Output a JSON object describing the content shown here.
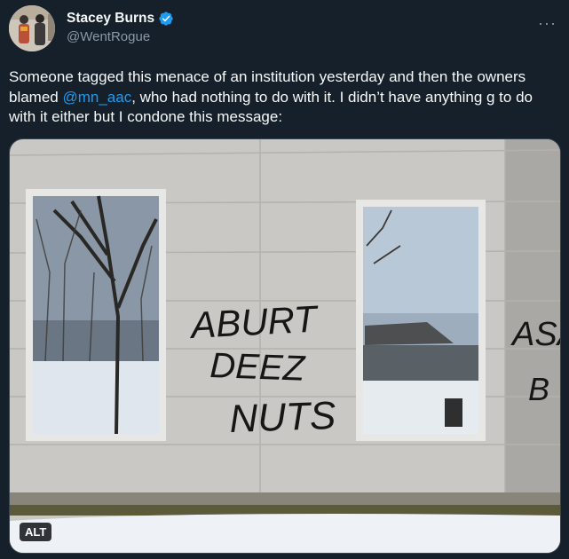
{
  "author": {
    "display_name": "Stacey Burns",
    "handle": "@WentRogue",
    "verified_icon": "verified-badge-icon"
  },
  "tweet": {
    "text_part1": "Someone tagged this menace of an institution yesterday and then the owners blamed ",
    "mention": "@mn_aac",
    "text_part2": ", who had nothing to do with it. I didn’t have anything g to do with it either but I condone this message:"
  },
  "media": {
    "graffiti_left": [
      "ABURT",
      "DEEZ",
      "NUTS"
    ],
    "graffiti_right": [
      "ASA",
      "B"
    ],
    "alt_label": "ALT"
  },
  "more_icon": "more-options-icon",
  "colors": {
    "background": "#15202b",
    "accent": "#1d9bf0",
    "text": "#f7f9f9",
    "muted": "#8b98a5"
  }
}
